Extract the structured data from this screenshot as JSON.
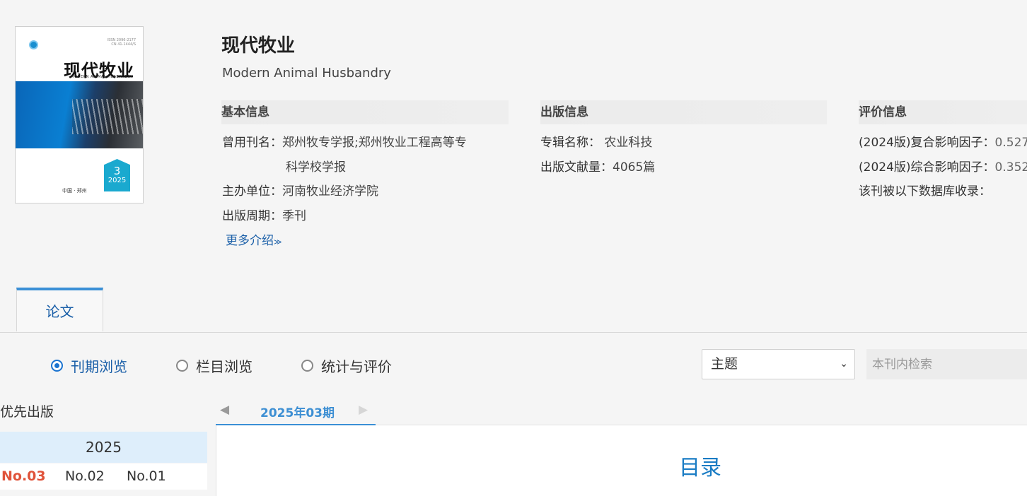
{
  "cover": {
    "title": "现代牧业",
    "subtitle": "MODERN ANIMAL HUSBANDRY",
    "issn_line1": "ISSN 2096-2177",
    "issn_line2": "CN 41-1444/S",
    "issue_number": "3",
    "issue_year": "2025",
    "place": "中国 · 郑州"
  },
  "journal": {
    "title": "现代牧业",
    "english_title": "Modern Animal Husbandry"
  },
  "basic_info": {
    "heading": "基本信息",
    "former_name_label": "曾用刊名：",
    "former_name_line1": "郑州牧专学报;郑州牧业工程高等专",
    "former_name_line2": "科学校学报",
    "sponsor_label": "主办单位：",
    "sponsor_value": "河南牧业经济学院",
    "cycle_label": "出版周期：",
    "cycle_value": "季刊",
    "more_label": "更多介绍",
    "more_icon": "double-chevron-down-icon"
  },
  "publish_info": {
    "heading": "出版信息",
    "album_label": "专辑名称：",
    "album_value": "农业科技",
    "count_label": "出版文献量：",
    "count_value": "4065篇"
  },
  "eval_info": {
    "heading": "评价信息",
    "composite_label": "(2024版)复合影响因子：",
    "composite_value": "0.527",
    "integrated_label": "(2024版)综合影响因子：",
    "integrated_value": "0.352",
    "databases_label": "该刊被以下数据库收录："
  },
  "tabs": [
    {
      "label": "论文"
    }
  ],
  "browse_modes": [
    {
      "label": "刊期浏览",
      "selected": true
    },
    {
      "label": "栏目浏览",
      "selected": false
    },
    {
      "label": "统计与评价",
      "selected": false
    }
  ],
  "search": {
    "select_value": "主题",
    "placeholder": "本刊内检索"
  },
  "sidebar": {
    "priority_label": "优先出版",
    "year": "2025",
    "issues": [
      {
        "label": "No.03",
        "active": true
      },
      {
        "label": "No.02",
        "active": false
      },
      {
        "label": "No.01",
        "active": false
      }
    ]
  },
  "issue_nav": {
    "current": "2025年03期",
    "prev_icon": "triangle-left-icon",
    "next_icon": "triangle-right-icon"
  },
  "toc": {
    "title": "目录"
  },
  "colors": {
    "accent_blue": "#1a5fa8",
    "active_issue_red": "#e0533a",
    "tab_border_blue": "#3a8fd6",
    "year_bar_bg": "#deeefb"
  }
}
